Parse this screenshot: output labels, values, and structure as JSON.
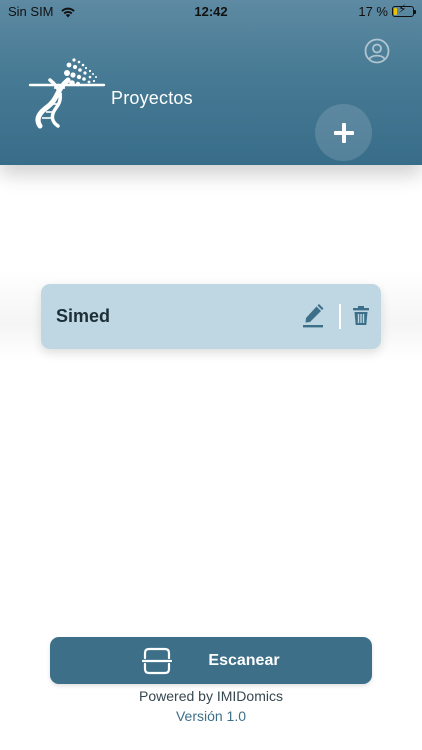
{
  "status_bar": {
    "carrier": "Sin SIM",
    "time": "12:42",
    "battery_percent": "17 %",
    "battery_level": 0.17
  },
  "header": {
    "title": "Proyectos",
    "logo_icon": "dna-helix-logo",
    "profile_icon": "user-circle-icon",
    "add_icon": "plus-icon"
  },
  "projects": [
    {
      "name": "Simed",
      "edit_icon": "pencil-icon",
      "delete_icon": "trash-icon"
    }
  ],
  "footer": {
    "scan_label": "Escanear",
    "scan_icon": "scan-frame-icon",
    "powered_by": "Powered by IMIDomics",
    "version": "Versión 1.0"
  },
  "colors": {
    "header": "#477a94",
    "card": "#bfd7e3",
    "primary_button": "#3d6f88",
    "version_text": "#3d6f88"
  }
}
